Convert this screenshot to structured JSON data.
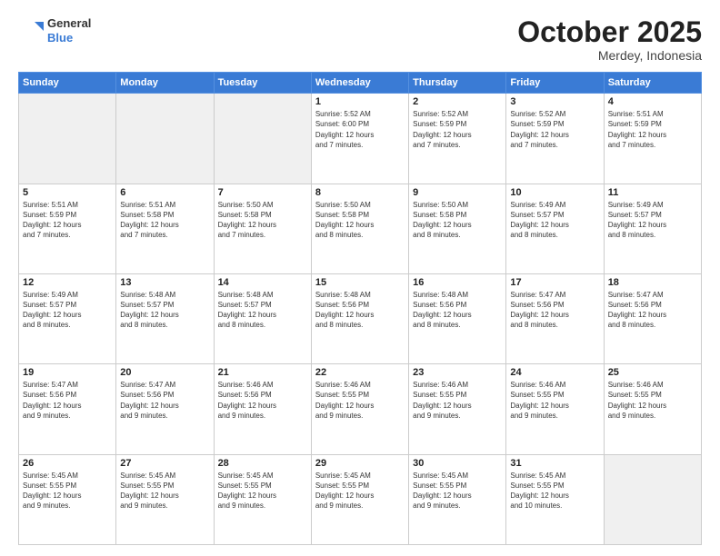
{
  "header": {
    "logo_general": "General",
    "logo_blue": "Blue",
    "month": "October 2025",
    "location": "Merdey, Indonesia"
  },
  "weekdays": [
    "Sunday",
    "Monday",
    "Tuesday",
    "Wednesday",
    "Thursday",
    "Friday",
    "Saturday"
  ],
  "weeks": [
    [
      {
        "day": "",
        "info": ""
      },
      {
        "day": "",
        "info": ""
      },
      {
        "day": "",
        "info": ""
      },
      {
        "day": "1",
        "info": "Sunrise: 5:52 AM\nSunset: 6:00 PM\nDaylight: 12 hours\nand 7 minutes."
      },
      {
        "day": "2",
        "info": "Sunrise: 5:52 AM\nSunset: 5:59 PM\nDaylight: 12 hours\nand 7 minutes."
      },
      {
        "day": "3",
        "info": "Sunrise: 5:52 AM\nSunset: 5:59 PM\nDaylight: 12 hours\nand 7 minutes."
      },
      {
        "day": "4",
        "info": "Sunrise: 5:51 AM\nSunset: 5:59 PM\nDaylight: 12 hours\nand 7 minutes."
      }
    ],
    [
      {
        "day": "5",
        "info": "Sunrise: 5:51 AM\nSunset: 5:59 PM\nDaylight: 12 hours\nand 7 minutes."
      },
      {
        "day": "6",
        "info": "Sunrise: 5:51 AM\nSunset: 5:58 PM\nDaylight: 12 hours\nand 7 minutes."
      },
      {
        "day": "7",
        "info": "Sunrise: 5:50 AM\nSunset: 5:58 PM\nDaylight: 12 hours\nand 7 minutes."
      },
      {
        "day": "8",
        "info": "Sunrise: 5:50 AM\nSunset: 5:58 PM\nDaylight: 12 hours\nand 8 minutes."
      },
      {
        "day": "9",
        "info": "Sunrise: 5:50 AM\nSunset: 5:58 PM\nDaylight: 12 hours\nand 8 minutes."
      },
      {
        "day": "10",
        "info": "Sunrise: 5:49 AM\nSunset: 5:57 PM\nDaylight: 12 hours\nand 8 minutes."
      },
      {
        "day": "11",
        "info": "Sunrise: 5:49 AM\nSunset: 5:57 PM\nDaylight: 12 hours\nand 8 minutes."
      }
    ],
    [
      {
        "day": "12",
        "info": "Sunrise: 5:49 AM\nSunset: 5:57 PM\nDaylight: 12 hours\nand 8 minutes."
      },
      {
        "day": "13",
        "info": "Sunrise: 5:48 AM\nSunset: 5:57 PM\nDaylight: 12 hours\nand 8 minutes."
      },
      {
        "day": "14",
        "info": "Sunrise: 5:48 AM\nSunset: 5:57 PM\nDaylight: 12 hours\nand 8 minutes."
      },
      {
        "day": "15",
        "info": "Sunrise: 5:48 AM\nSunset: 5:56 PM\nDaylight: 12 hours\nand 8 minutes."
      },
      {
        "day": "16",
        "info": "Sunrise: 5:48 AM\nSunset: 5:56 PM\nDaylight: 12 hours\nand 8 minutes."
      },
      {
        "day": "17",
        "info": "Sunrise: 5:47 AM\nSunset: 5:56 PM\nDaylight: 12 hours\nand 8 minutes."
      },
      {
        "day": "18",
        "info": "Sunrise: 5:47 AM\nSunset: 5:56 PM\nDaylight: 12 hours\nand 8 minutes."
      }
    ],
    [
      {
        "day": "19",
        "info": "Sunrise: 5:47 AM\nSunset: 5:56 PM\nDaylight: 12 hours\nand 9 minutes."
      },
      {
        "day": "20",
        "info": "Sunrise: 5:47 AM\nSunset: 5:56 PM\nDaylight: 12 hours\nand 9 minutes."
      },
      {
        "day": "21",
        "info": "Sunrise: 5:46 AM\nSunset: 5:56 PM\nDaylight: 12 hours\nand 9 minutes."
      },
      {
        "day": "22",
        "info": "Sunrise: 5:46 AM\nSunset: 5:55 PM\nDaylight: 12 hours\nand 9 minutes."
      },
      {
        "day": "23",
        "info": "Sunrise: 5:46 AM\nSunset: 5:55 PM\nDaylight: 12 hours\nand 9 minutes."
      },
      {
        "day": "24",
        "info": "Sunrise: 5:46 AM\nSunset: 5:55 PM\nDaylight: 12 hours\nand 9 minutes."
      },
      {
        "day": "25",
        "info": "Sunrise: 5:46 AM\nSunset: 5:55 PM\nDaylight: 12 hours\nand 9 minutes."
      }
    ],
    [
      {
        "day": "26",
        "info": "Sunrise: 5:45 AM\nSunset: 5:55 PM\nDaylight: 12 hours\nand 9 minutes."
      },
      {
        "day": "27",
        "info": "Sunrise: 5:45 AM\nSunset: 5:55 PM\nDaylight: 12 hours\nand 9 minutes."
      },
      {
        "day": "28",
        "info": "Sunrise: 5:45 AM\nSunset: 5:55 PM\nDaylight: 12 hours\nand 9 minutes."
      },
      {
        "day": "29",
        "info": "Sunrise: 5:45 AM\nSunset: 5:55 PM\nDaylight: 12 hours\nand 9 minutes."
      },
      {
        "day": "30",
        "info": "Sunrise: 5:45 AM\nSunset: 5:55 PM\nDaylight: 12 hours\nand 9 minutes."
      },
      {
        "day": "31",
        "info": "Sunrise: 5:45 AM\nSunset: 5:55 PM\nDaylight: 12 hours\nand 10 minutes."
      },
      {
        "day": "",
        "info": ""
      }
    ]
  ]
}
